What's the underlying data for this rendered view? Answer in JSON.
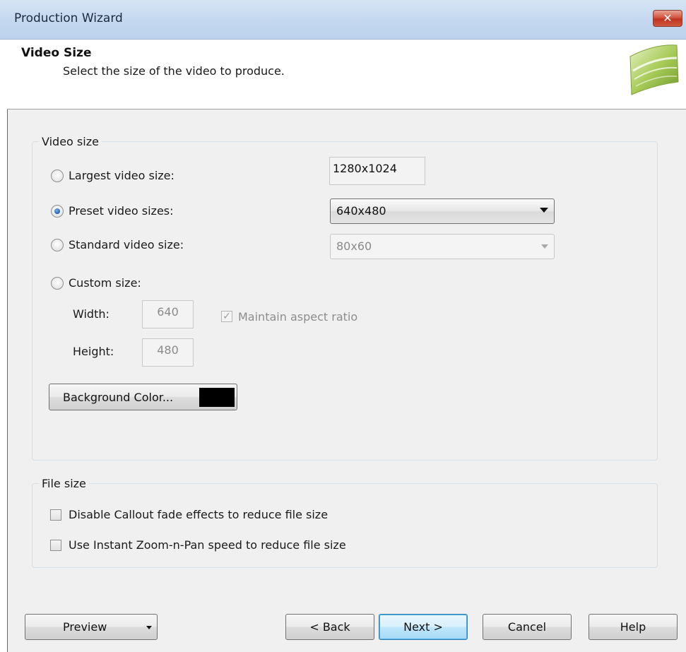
{
  "window": {
    "title": "Production Wizard"
  },
  "header": {
    "title": "Video Size",
    "subtitle": "Select the size of the video to produce."
  },
  "video_size_group": {
    "label": "Video size",
    "options": {
      "largest": {
        "label": "Largest video size:",
        "value": "1280x1024",
        "selected": false
      },
      "preset": {
        "label": "Preset video sizes:",
        "value": "640x480",
        "selected": true
      },
      "standard": {
        "label": "Standard video size:",
        "value": "80x60",
        "selected": false,
        "enabled": false
      },
      "custom": {
        "label": "Custom size:",
        "selected": false
      }
    },
    "width": {
      "label": "Width:",
      "value": "640"
    },
    "height": {
      "label": "Height:",
      "value": "480"
    },
    "maintain_aspect": {
      "label": "Maintain aspect ratio",
      "checked": true,
      "enabled": false
    },
    "background_color": {
      "label": "Background Color...",
      "color": "#000000"
    }
  },
  "file_size_group": {
    "label": "File size",
    "disable_callout": {
      "label": "Disable Callout fade effects to reduce file size",
      "checked": false
    },
    "instant_zoom": {
      "label": "Use Instant Zoom-n-Pan speed to reduce file size",
      "checked": false
    }
  },
  "footer": {
    "preview_label": "Preview",
    "back_label": "< Back",
    "next_label": "Next >",
    "cancel_label": "Cancel",
    "help_label": "Help"
  },
  "icons": {
    "close": "close-icon",
    "logo": "wizard-logo-icon",
    "dropdown": "chevron-down-icon"
  },
  "colors": {
    "titlebar": "#c3d7ef",
    "panel": "#f0f0f0",
    "close_button": "#c0351f",
    "default_button": "#bee6fd"
  }
}
